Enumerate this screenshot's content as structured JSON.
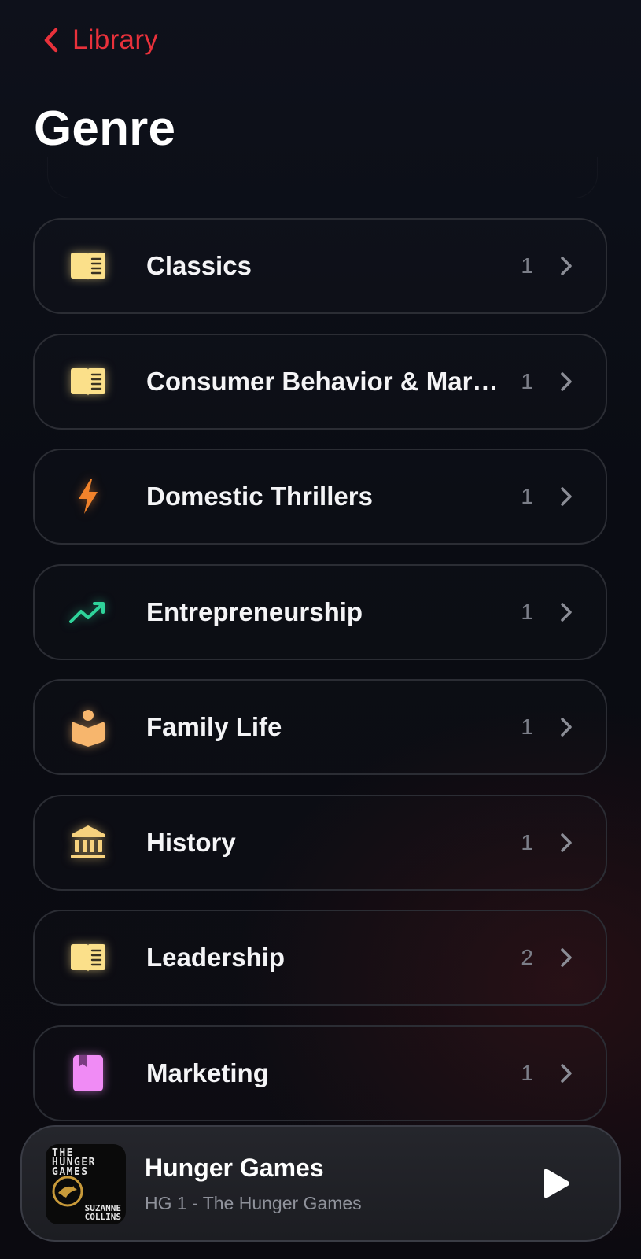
{
  "nav": {
    "back_label": "Library"
  },
  "page": {
    "title": "Genre"
  },
  "genres": [
    {
      "name": "Classics",
      "count": "1",
      "icon": "book-icon",
      "color": "#fbe08a"
    },
    {
      "name": "Consumer Behavior & Mar…",
      "count": "1",
      "icon": "book-icon",
      "color": "#fbe08a"
    },
    {
      "name": "Domestic Thrillers",
      "count": "1",
      "icon": "lightning-icon",
      "color": "#f2832b"
    },
    {
      "name": "Entrepreneurship",
      "count": "1",
      "icon": "trending-up-icon",
      "color": "#2fd39a"
    },
    {
      "name": "Family Life",
      "count": "1",
      "icon": "reading-person-icon",
      "color": "#f7b66d"
    },
    {
      "name": "History",
      "count": "1",
      "icon": "museum-icon",
      "color": "#f7d27e"
    },
    {
      "name": "Leadership",
      "count": "2",
      "icon": "book-icon",
      "color": "#fbe08a"
    },
    {
      "name": "Marketing",
      "count": "1",
      "icon": "bookmark-book-icon",
      "color": "#f08bf5"
    }
  ],
  "player": {
    "title": "Hunger Games",
    "subtitle": "HG 1 - The Hunger Games",
    "cover_top": "THE\nHUNGER\nGAMES",
    "cover_author": "SUZANNE\nCOLLINS"
  },
  "colors": {
    "accent": "#e8313b",
    "chevron": "#8b8d96"
  }
}
